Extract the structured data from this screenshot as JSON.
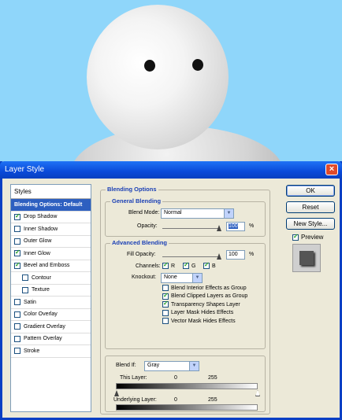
{
  "window": {
    "title": "Layer Style",
    "close": "×"
  },
  "styles": {
    "header": "Styles",
    "items": [
      {
        "label": "Blending Options: Default",
        "checkbox": false,
        "checked": false,
        "selected": true,
        "indent": false
      },
      {
        "label": "Drop Shadow",
        "checkbox": true,
        "checked": true,
        "indent": false
      },
      {
        "label": "Inner Shadow",
        "checkbox": true,
        "checked": false,
        "indent": false
      },
      {
        "label": "Outer Glow",
        "checkbox": true,
        "checked": false,
        "indent": false
      },
      {
        "label": "Inner Glow",
        "checkbox": true,
        "checked": true,
        "indent": false
      },
      {
        "label": "Bevel and Emboss",
        "checkbox": true,
        "checked": true,
        "indent": false
      },
      {
        "label": "Contour",
        "checkbox": true,
        "checked": false,
        "indent": true
      },
      {
        "label": "Texture",
        "checkbox": true,
        "checked": false,
        "indent": true
      },
      {
        "label": "Satin",
        "checkbox": true,
        "checked": false,
        "indent": false
      },
      {
        "label": "Color Overlay",
        "checkbox": true,
        "checked": false,
        "indent": false
      },
      {
        "label": "Gradient Overlay",
        "checkbox": true,
        "checked": false,
        "indent": false
      },
      {
        "label": "Pattern Overlay",
        "checkbox": true,
        "checked": false,
        "indent": false
      },
      {
        "label": "Stroke",
        "checkbox": true,
        "checked": false,
        "indent": false
      }
    ]
  },
  "blending": {
    "title": "Blending Options",
    "general_title": "General Blending",
    "blend_mode_label": "Blend Mode:",
    "blend_mode_value": "Normal",
    "opacity_label": "Opacity:",
    "opacity_value": "100",
    "percent": "%"
  },
  "advanced": {
    "title": "Advanced Blending",
    "fill_label": "Fill Opacity:",
    "fill_value": "100",
    "percent": "%",
    "channels_label": "Channels:",
    "channel_r": "R",
    "channel_g": "G",
    "channel_b": "B",
    "knockout_label": "Knockout:",
    "knockout_value": "None",
    "options": [
      {
        "label": "Blend Interior Effects as Group",
        "checked": false
      },
      {
        "label": "Blend Clipped Layers as Group",
        "checked": true
      },
      {
        "label": "Transparency Shapes Layer",
        "checked": true
      },
      {
        "label": "Layer Mask Hides Effects",
        "checked": false
      },
      {
        "label": "Vector Mask Hides Effects",
        "checked": false
      }
    ]
  },
  "blend_if": {
    "label": "Blend If:",
    "value": "Gray",
    "this_layer_label": "This Layer:",
    "this_min": "0",
    "this_max": "255",
    "underlying_label": "Underlying Layer:",
    "under_min": "0",
    "under_max": "255"
  },
  "buttons": {
    "ok": "OK",
    "reset": "Reset",
    "new_style": "New Style...",
    "preview_label": "Preview",
    "preview_checked": true
  },
  "icons": {
    "dropdown": "▼",
    "slider_thumb": "triangle-up"
  }
}
